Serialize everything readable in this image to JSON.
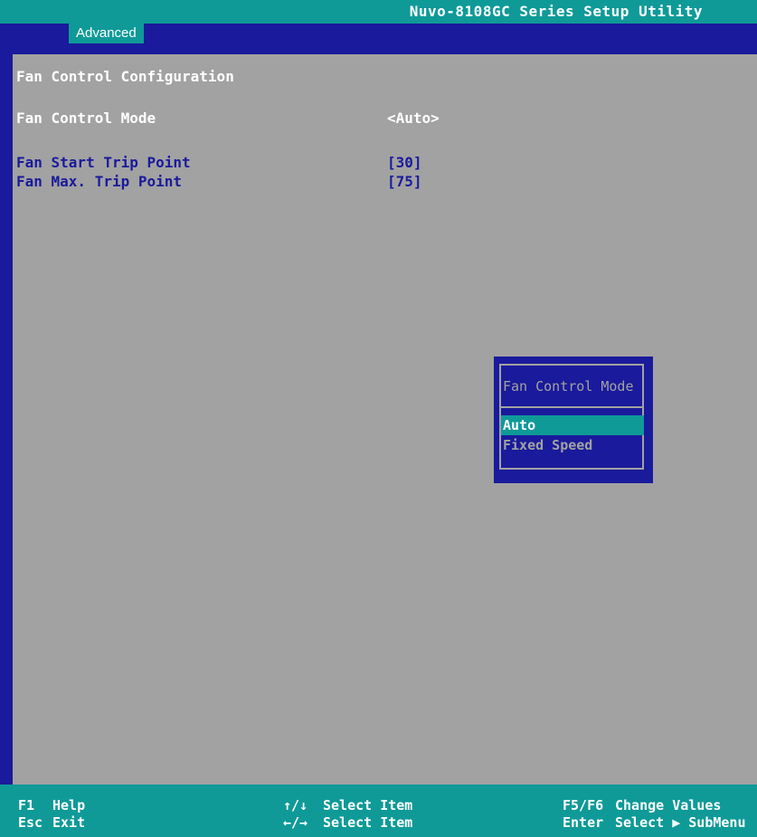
{
  "header": {
    "title": "Nuvo-8108GC Series Setup Utility"
  },
  "tabs": [
    {
      "label": "Advanced"
    }
  ],
  "page": {
    "section_title": "Fan Control Configuration",
    "items": [
      {
        "label": "Fan Control Mode",
        "value": "<Auto>"
      },
      {
        "label": "Fan Start Trip Point",
        "value": "[30]"
      },
      {
        "label": "Fan Max. Trip Point",
        "value": "[75]"
      }
    ]
  },
  "popup": {
    "title": "Fan Control Mode",
    "options": [
      "Auto",
      "Fixed Speed"
    ],
    "selected": "Auto"
  },
  "footer": {
    "keys": [
      {
        "key": "F1",
        "desc": "Help"
      },
      {
        "key": "Esc",
        "desc": "Exit"
      },
      {
        "key": "↑/↓",
        "desc": "Select Item"
      },
      {
        "key": "←/→",
        "desc": "Select Item"
      },
      {
        "key": "F5/F6",
        "desc": "Change Values"
      },
      {
        "key": "Enter",
        "desc": "Select ▶ SubMenu"
      }
    ]
  },
  "colors": {
    "bios_blue": "#1a1a9c",
    "teal": "#0f9a98",
    "panel_gray": "#a2a2a2"
  }
}
